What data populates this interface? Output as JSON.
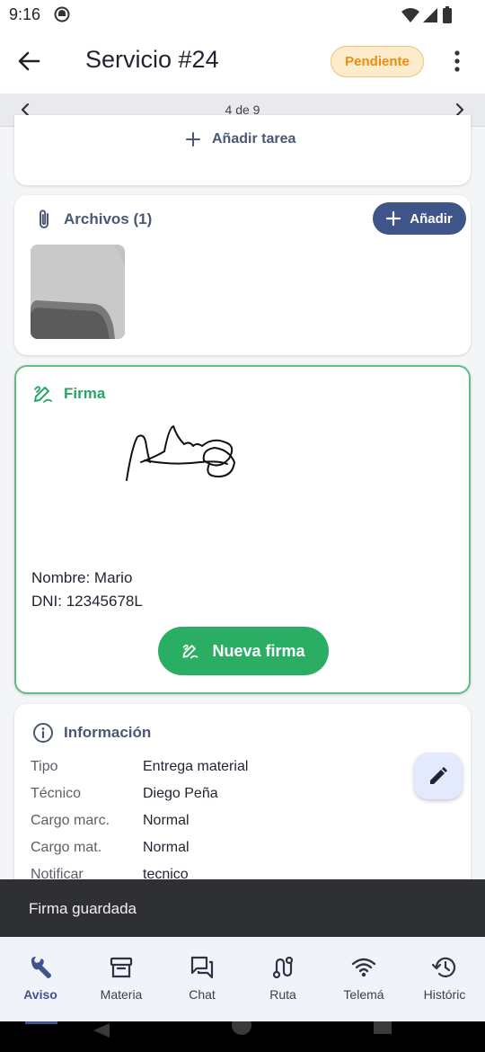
{
  "status_bar": {
    "time": "9:16"
  },
  "header": {
    "title": "Servicio #24",
    "status": "Pendiente"
  },
  "pager": {
    "label": "4 de 9"
  },
  "tasks": {
    "add_label": "Añadir tarea"
  },
  "files": {
    "title": "Archivos (1)",
    "add_label": "Añadir"
  },
  "signature": {
    "title": "Firma",
    "name_line": "Nombre: Mario",
    "dni_line": "DNI: 12345678L",
    "new_button": "Nueva firma"
  },
  "info": {
    "title": "Información",
    "rows": [
      {
        "label": "Tipo",
        "value": "Entrega material"
      },
      {
        "label": "Técnico",
        "value": "Diego Peña"
      },
      {
        "label": "Cargo marc.",
        "value": "Normal"
      },
      {
        "label": "Cargo mat.",
        "value": "Normal"
      },
      {
        "label": "Notificar",
        "value": "tecnico"
      }
    ]
  },
  "snackbar": {
    "message": "Firma guardada"
  },
  "bottom_nav": {
    "items": [
      {
        "label": "Aviso",
        "icon": "wrench-icon"
      },
      {
        "label": "Materia",
        "icon": "archive-icon"
      },
      {
        "label": "Chat",
        "icon": "chat-icon"
      },
      {
        "label": "Ruta",
        "icon": "route-icon"
      },
      {
        "label": "Telemá",
        "icon": "wifi-icon"
      },
      {
        "label": "Históric",
        "icon": "history-icon"
      }
    ]
  },
  "colors": {
    "accent": "#3f5489",
    "success": "#2aae63",
    "pending_bg": "#fdeccc",
    "pending_text": "#e98d12",
    "snackbar_bg": "#2f3033"
  }
}
